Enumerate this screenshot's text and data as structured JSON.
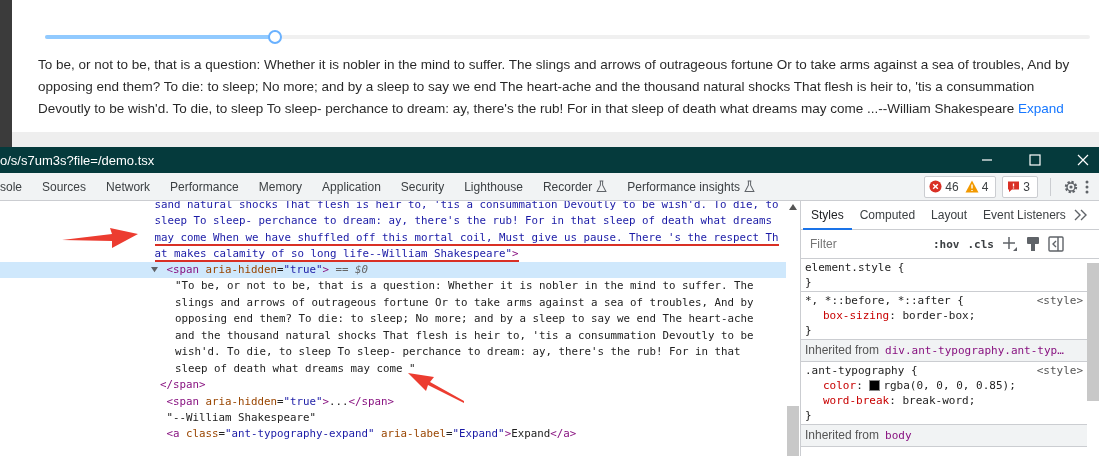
{
  "page": {
    "slider": {
      "level": 0.22
    },
    "paragraph": "To be, or not to be, that is a question: Whether it is nobler in the mind to suffer. The slings and arrows of outrageous fortune Or to take arms against a sea of troubles, And by opposing end them? To die: to sleep; No more; and by a sleep to say we end The heart-ache and the thousand natural shocks That flesh is heir to, 'tis a consummation Devoutly to be wish'd. To die, to sleep To sleep- perchance to dream: ay, there's the rub! For in that sleep of death what dreams may come ...--William Shakespeare",
    "link": "Expand"
  },
  "window": {
    "title": "o/s/s7um3s?file=/demo.tsx"
  },
  "tabs": [
    {
      "label": "sole",
      "experimental": false
    },
    {
      "label": "Sources",
      "experimental": false
    },
    {
      "label": "Network",
      "experimental": false
    },
    {
      "label": "Performance",
      "experimental": false
    },
    {
      "label": "Memory",
      "experimental": false
    },
    {
      "label": "Application",
      "experimental": false
    },
    {
      "label": "Security",
      "experimental": false
    },
    {
      "label": "Lighthouse",
      "experimental": false
    },
    {
      "label": "Recorder",
      "experimental": true
    },
    {
      "label": "Performance insights",
      "experimental": true
    }
  ],
  "counters": {
    "errors": "46",
    "warnings": "4",
    "issues": "3"
  },
  "elements_panel": {
    "root": {
      "lines": [
        {
          "underlined": false,
          "tokens": [
            {
              "kind": "value",
              "text": "sand natural shocks That flesh is heir to, 'tis a consummation Devoutly to be wish'd. To die, to"
            }
          ]
        },
        {
          "underlined": false,
          "tokens": [
            {
              "kind": "value",
              "text": "sleep To sleep- perchance to dream: ay, there's the rub! For in that sleep of death what dreams"
            }
          ]
        },
        {
          "underlined": true,
          "tokens": [
            {
              "kind": "value",
              "text": "may come When we have shuffled off this mortal coil, Must give us pause. There 's the respect Th"
            }
          ]
        },
        {
          "underlined": true,
          "tokens": [
            {
              "kind": "value",
              "text": "at makes calamity of so long life--William Shakespeare\""
            },
            {
              "kind": "tag",
              "text": ">"
            }
          ]
        }
      ],
      "children": [
        {
          "expanded": true,
          "selected": true,
          "lines": [
            {
              "underlined": false,
              "tokens": [
                {
                  "kind": "tag",
                  "text": "<span"
                },
                {
                  "kind": "attr",
                  "text": " aria-hidden"
                },
                {
                  "kind": "plain",
                  "text": "="
                },
                {
                  "kind": "value",
                  "text": "\"true\""
                },
                {
                  "kind": "tag",
                  "text": ">"
                },
                {
                  "kind": "marker",
                  "text": " == $0"
                }
              ]
            }
          ],
          "text_lines": [
            "\"To be, or not to be, that is a question: Whether it is nobler in the mind to suffer. The",
            "slings and arrows of outrageous fortune Or to take arms against a sea of troubles, And by",
            "opposing end them? To die: to sleep; No more; and by a sleep to say we end The heart-ache",
            "and the thousand natural shocks That flesh is heir to, 'tis a consummation Devoutly to be",
            "wish'd. To die, to sleep To sleep- perchance to dream: ay, there's the rub! For in that",
            "sleep of death what dreams may come \""
          ],
          "close": [
            {
              "kind": "tag",
              "text": "</span>"
            }
          ]
        },
        {
          "lines": [
            {
              "underlined": false,
              "tokens": [
                {
                  "kind": "tag",
                  "text": "<span"
                },
                {
                  "kind": "attr",
                  "text": " aria-hidden"
                },
                {
                  "kind": "plain",
                  "text": "="
                },
                {
                  "kind": "value",
                  "text": "\"true\""
                },
                {
                  "kind": "tag",
                  "text": ">"
                },
                {
                  "kind": "plain",
                  "text": "..."
                },
                {
                  "kind": "tag",
                  "text": "</span>"
                }
              ]
            }
          ]
        },
        {
          "lines": [
            {
              "underlined": false,
              "tokens": [
                {
                  "kind": "text",
                  "text": "\"--William Shakespeare\""
                }
              ]
            }
          ]
        },
        {
          "lines": [
            {
              "underlined": false,
              "tokens": [
                {
                  "kind": "tag",
                  "text": "<a"
                },
                {
                  "kind": "attr",
                  "text": " class"
                },
                {
                  "kind": "plain",
                  "text": "="
                },
                {
                  "kind": "value",
                  "text": "\"ant-typography-expand\""
                },
                {
                  "kind": "attr",
                  "text": " aria-label"
                },
                {
                  "kind": "plain",
                  "text": "="
                },
                {
                  "kind": "value",
                  "text": "\"Expand\""
                },
                {
                  "kind": "tag",
                  "text": ">"
                },
                {
                  "kind": "plain",
                  "text": "Expand"
                },
                {
                  "kind": "tag",
                  "text": "</a>"
                }
              ]
            }
          ]
        }
      ]
    }
  },
  "styles_panel": {
    "tabs": [
      {
        "label": "Styles",
        "selected": true
      },
      {
        "label": "Computed",
        "selected": false
      },
      {
        "label": "Layout",
        "selected": false
      },
      {
        "label": "Event Listeners",
        "selected": false
      }
    ],
    "filter": {
      "placeholder": "Filter"
    },
    "toggles": [
      ":hov",
      ".cls"
    ],
    "sections": [
      {
        "kind": "rule",
        "selector": "element.style {",
        "close": "}"
      },
      {
        "kind": "rule",
        "selector": "*, *::before, *::after {",
        "source": "<style>",
        "declarations": [
          {
            "name": "box-sizing",
            "sep": ": ",
            "value": "border-box;"
          }
        ],
        "close": "}"
      },
      {
        "kind": "inherited",
        "label": "Inherited from",
        "target": "div.ant-typography.ant-typ…"
      },
      {
        "kind": "rule",
        "selector": ".ant-typography {",
        "source": "<style>",
        "declarations": [
          {
            "name": "color",
            "sep": ": ",
            "value": "rgba(0, 0, 0, 0.85);",
            "color": "#000000"
          },
          {
            "name": "word-break",
            "sep": ": ",
            "value": "break-word;"
          }
        ],
        "close": "}"
      },
      {
        "kind": "inherited",
        "label": "Inherited from",
        "target": "body"
      }
    ]
  }
}
